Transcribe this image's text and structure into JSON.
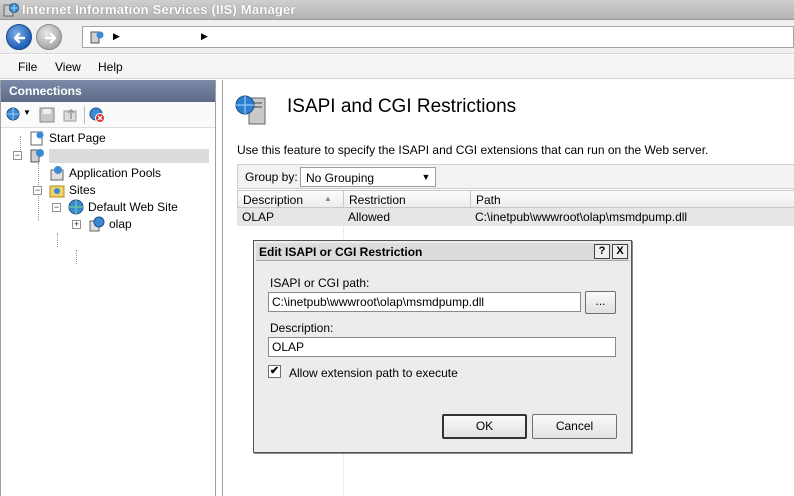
{
  "window": {
    "title": "Internet Information Services (IIS) Manager"
  },
  "menu": {
    "file": "File",
    "view": "View",
    "help": "Help"
  },
  "connections": {
    "header": "Connections",
    "tree": {
      "start_page": "Start Page",
      "application_pools": "Application Pools",
      "sites": "Sites",
      "default_web_site": "Default Web Site",
      "olap": "olap"
    }
  },
  "feature": {
    "title": "ISAPI and CGI Restrictions",
    "description": "Use this feature to specify the ISAPI and CGI extensions that can run on the Web server.",
    "group_by_label": "Group by:",
    "group_by_value": "No Grouping",
    "columns": [
      "Description",
      "Restriction",
      "Path"
    ],
    "rows": [
      {
        "description": "OLAP",
        "restriction": "Allowed",
        "path": "C:\\inetpub\\wwwroot\\olap\\msmdpump.dll"
      }
    ]
  },
  "dialog": {
    "title": "Edit ISAPI or CGI Restriction",
    "help_btn": "?",
    "close_btn": "X",
    "path_label": "ISAPI or CGI path:",
    "path_value": "C:\\inetpub\\wwwroot\\olap\\msmdpump.dll",
    "browse_label": "...",
    "description_label": "Description:",
    "description_value": "OLAP",
    "checkbox_label": "Allow extension path to execute",
    "checkbox_checked": "✔",
    "ok_label": "OK",
    "cancel_label": "Cancel"
  },
  "colors": {
    "title_bar": "#b4b4b4",
    "connections_header": "#5c6b88",
    "selected_row": "#e6e6e6",
    "back_button": "#1f5fb8"
  },
  "icons": {
    "app": "iis-globe-icon",
    "back": "back-arrow-icon",
    "forward": "forward-arrow-icon",
    "feature": "isapi-cgi-server-icon"
  }
}
